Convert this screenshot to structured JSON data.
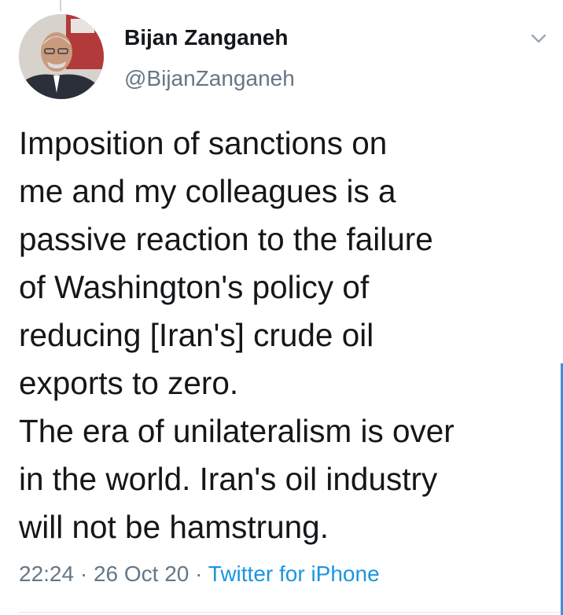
{
  "author": {
    "display_name": "Bijan Zanganeh",
    "handle": "@BijanZanganeh"
  },
  "tweet": {
    "text": "Imposition of sanctions on\nme and my colleagues is a\npassive reaction to the failure\nof Washington's policy of\nreducing [Iran's] crude oil\nexports to zero.\nThe era of unilateralism is over\nin the world. Iran's oil industry\nwill not be hamstrung.",
    "time": "22:24",
    "date": "26 Oct 20",
    "separator": "·",
    "source": "Twitter for iPhone"
  },
  "icons": {
    "menu": "chevron-down-icon"
  },
  "colors": {
    "text_primary": "#14171a",
    "text_secondary": "#657786",
    "link": "#1b95e0",
    "divider": "#e1e8ed",
    "scroll_indicator": "#3e8fdb"
  }
}
